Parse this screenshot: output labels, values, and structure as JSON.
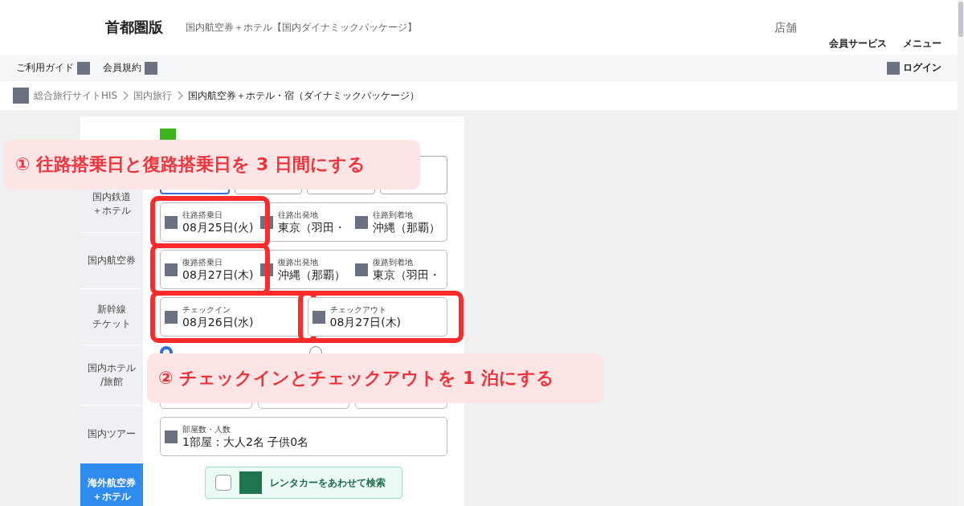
{
  "header": {
    "edition": "首都圏版",
    "subtitle": "国内航空券＋ホテル【国内ダイナミックパッケージ】",
    "store": "店舗",
    "links": [
      "会員サービス",
      "メニュー"
    ]
  },
  "nav": {
    "links": [
      "ご利用ガイド",
      "会員規約"
    ],
    "login": "ログイン"
  },
  "breadcrumb": [
    {
      "label": "総合旅行サイトHIS",
      "current": false
    },
    {
      "label": "国内旅行",
      "current": false
    },
    {
      "label": "国内航空券＋ホテル・宿（ダイナミックパッケージ）",
      "current": true
    }
  ],
  "sidebar": {
    "items": [
      {
        "selected": true,
        "kind": "normal"
      },
      {
        "lines": [
          "国内鉄道",
          "＋ホテル"
        ],
        "selected": false,
        "kind": "normal"
      },
      {
        "lines": [
          "国内航空券"
        ],
        "selected": false,
        "kind": "normal"
      },
      {
        "lines": [
          "新幹線",
          "チケット"
        ],
        "selected": false,
        "kind": "normal"
      },
      {
        "lines": [
          "国内ホテル",
          "/旅館"
        ],
        "selected": false,
        "kind": "normal"
      },
      {
        "lines": [
          "国内ツアー"
        ],
        "selected": false,
        "kind": "normal"
      },
      {
        "lines": [
          "海外航空券",
          "＋ホテル"
        ],
        "selected": false,
        "kind": "accent"
      }
    ]
  },
  "form": {
    "type_options": [
      {
        "selected": true
      },
      {
        "selected": false
      },
      {
        "selected": false
      },
      {
        "selected": false
      }
    ],
    "flight_rows": [
      {
        "fields": [
          {
            "label": "往路搭乗日",
            "value": "08月25日(火)",
            "highlighted": true
          },
          {
            "label": "往路出発地",
            "value": "東京（羽田・",
            "highlighted": false
          },
          {
            "label": "往路到着地",
            "value": "沖縄（那覇）",
            "highlighted": false
          }
        ]
      },
      {
        "fields": [
          {
            "label": "復路搭乗日",
            "value": "08月27日(木)",
            "highlighted": true
          },
          {
            "label": "復路出発地",
            "value": "沖縄（那覇）",
            "highlighted": false
          },
          {
            "label": "復路到着地",
            "value": "東京（羽田・",
            "highlighted": false
          }
        ]
      }
    ],
    "stay_fields": [
      {
        "label": "チェックイン",
        "value": "08月26日(水)",
        "highlighted": true
      },
      {
        "label": "チェックアウト",
        "value": "08月27日(木)",
        "highlighted": true
      }
    ],
    "search_types": [
      {
        "selected": true
      },
      {
        "selected": false
      }
    ],
    "rooms": {
      "label": "部屋数・人数",
      "value": "1部屋：大人2名 子供0名"
    },
    "rental_car": {
      "label": "レンタカーをあわせて検索",
      "checked": false
    }
  },
  "callouts": [
    "① 往路搭乗日と復路搭乗日を 3 日間にする",
    "② チェックインとチェックアウトを 1 泊にする"
  ]
}
